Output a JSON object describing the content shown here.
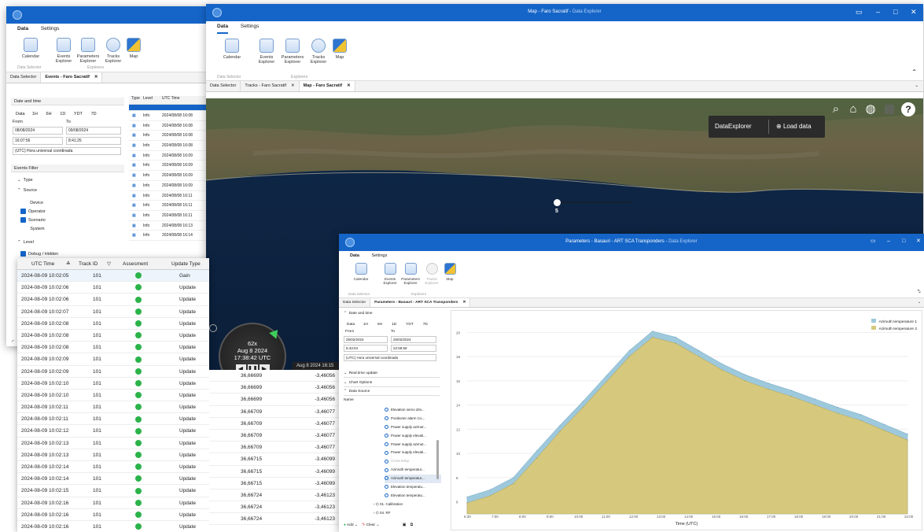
{
  "window_a": {
    "menu": [
      "Data",
      "Settings"
    ],
    "ribbon_buttons": [
      "Calendar",
      "Events Explorer",
      "Parameters Explorer",
      "Tracks Explorer",
      "Map"
    ],
    "group_labels": [
      "Data Selector",
      "Explorers"
    ],
    "tabs": [
      "Data Selector",
      "Events - Faro Sacratif"
    ],
    "date_time_label": "Date and time",
    "ranges": [
      "Data",
      "1H",
      "6H",
      "1D",
      "YDT",
      "7D"
    ],
    "from_label": "From",
    "to_label": "To",
    "from_date": "08/08/2024",
    "to_date": "09/08/2024",
    "from_time": "16:07:56",
    "to_time": "8:41:25",
    "timezone": "(UTC) Hora universal coordinada",
    "events_filter": "Events Filter",
    "type_label": "Type",
    "source_label": "Source",
    "sources": [
      "Device",
      "Operator",
      "Scenario",
      "System"
    ],
    "level_label": "Level",
    "level_item": "Debug / Hidden",
    "table_headers": [
      "Type",
      "Level",
      "UTC Time"
    ],
    "rows": [
      {
        "level": "Info",
        "time": "2024/08/08 16:08"
      },
      {
        "level": "Info",
        "time": "2024/08/08 16:08"
      },
      {
        "level": "Info",
        "time": "2024/08/08 16:08"
      },
      {
        "level": "Info",
        "time": "2024/08/08 16:08"
      },
      {
        "level": "Info",
        "time": "2024/08/08 16:09"
      },
      {
        "level": "Info",
        "time": "2024/08/08 16:09"
      },
      {
        "level": "Info",
        "time": "2024/08/08 16:09"
      },
      {
        "level": "Info",
        "time": "2024/08/08 16:09"
      },
      {
        "level": "Info",
        "time": "2024/08/08 16:11"
      },
      {
        "level": "Info",
        "time": "2024/08/08 16:11"
      },
      {
        "level": "Info",
        "time": "2024/08/08 16:11"
      },
      {
        "level": "Info",
        "time": "2024/08/08 16:13"
      },
      {
        "level": "Info",
        "time": "2024/08/08 16:14"
      }
    ]
  },
  "window_b": {
    "title": "Map - Faro Sacratif",
    "title_app": "Data Explorer",
    "menu": [
      "Data",
      "Settings"
    ],
    "ribbon_buttons": [
      "Calendar",
      "Events Explorer",
      "Parameters Explorer",
      "Tracks Explorer",
      "Map"
    ],
    "group_labels": [
      "Data Selector",
      "Explorers"
    ],
    "tabs": [
      "Data Selector",
      "Tracks - Faro Sacratif",
      "Map - Faro Sacratif"
    ],
    "hud_title": "DataExplorer",
    "load_data": "Load data",
    "marker_label": "5",
    "player": {
      "speed": "62x",
      "date": "Aug 8 2024",
      "time": "17:38:42 UTC"
    },
    "timeline_label": "Aug 8 2024 16:15"
  },
  "track_table": {
    "headers": [
      "UTC Time",
      "Track ID",
      "Assesment",
      "Update Type"
    ],
    "rows": [
      {
        "time": "2024-08-09 10:02:05",
        "id": "101",
        "type": "Gain",
        "lat": "",
        "lon": ""
      },
      {
        "time": "2024-08-09 10:02:06",
        "id": "101",
        "type": "Update",
        "lat": "",
        "lon": ""
      },
      {
        "time": "2024-08-09 10:02:06",
        "id": "101",
        "type": "Update",
        "lat": "",
        "lon": ""
      },
      {
        "time": "2024-08-09 10:02:07",
        "id": "101",
        "type": "Update",
        "lat": "",
        "lon": ""
      },
      {
        "time": "2024-08-09 10:02:08",
        "id": "101",
        "type": "Update",
        "lat": "",
        "lon": ""
      },
      {
        "time": "2024-08-09 10:02:08",
        "id": "101",
        "type": "Update",
        "lat": "",
        "lon": ""
      },
      {
        "time": "2024-08-09 10:02:08",
        "id": "101",
        "type": "Update",
        "lat": "",
        "lon": ""
      },
      {
        "time": "2024-08-09 10:02:09",
        "id": "101",
        "type": "Update",
        "lat": "36,66699",
        "lon": "-3,46056"
      },
      {
        "time": "2024-08-09 10:02:09",
        "id": "101",
        "type": "Update",
        "lat": "36,66699",
        "lon": "-3,46056"
      },
      {
        "time": "2024-08-09 10:02:10",
        "id": "101",
        "type": "Update",
        "lat": "36,66699",
        "lon": "-3,46056"
      },
      {
        "time": "2024-08-09 10:02:10",
        "id": "101",
        "type": "Update",
        "lat": "36,66699",
        "lon": "-3,46056"
      },
      {
        "time": "2024-08-09 10:02:11",
        "id": "101",
        "type": "Update",
        "lat": "36,66699",
        "lon": "-3,46056"
      },
      {
        "time": "2024-08-09 10:02:11",
        "id": "101",
        "type": "Update",
        "lat": "36,66709",
        "lon": "-3,46077"
      },
      {
        "time": "2024-08-09 10:02:12",
        "id": "101",
        "type": "Update",
        "lat": "36,66709",
        "lon": "-3,46077"
      },
      {
        "time": "2024-08-09 10:02:13",
        "id": "101",
        "type": "Update",
        "lat": "36,66709",
        "lon": "-3,46077"
      },
      {
        "time": "2024-08-09 10:02:13",
        "id": "101",
        "type": "Update",
        "lat": "36,66709",
        "lon": "-3,46077"
      },
      {
        "time": "2024-08-09 10:02:14",
        "id": "101",
        "type": "Update",
        "lat": "36,66715",
        "lon": "-3,46099"
      },
      {
        "time": "2024-08-09 10:02:14",
        "id": "101",
        "type": "Update",
        "lat": "36,66715",
        "lon": "-3,46099"
      },
      {
        "time": "2024-08-09 10:02:15",
        "id": "101",
        "type": "Update",
        "lat": "36,66715",
        "lon": "-3,46099"
      },
      {
        "time": "2024-08-09 10:02:16",
        "id": "101",
        "type": "Update",
        "lat": "36,66724",
        "lon": "-3,46123"
      },
      {
        "time": "2024-08-09 10:02:16",
        "id": "101",
        "type": "Update",
        "lat": "36,66724",
        "lon": "-3,46123"
      },
      {
        "time": "2024-08-09 10:02:16",
        "id": "101",
        "type": "Update",
        "lat": "36,66724",
        "lon": "-3,46123"
      }
    ]
  },
  "window_c": {
    "title": "Parameters - Basauri - ART SCA Transponders",
    "title_app": "Data Explorer",
    "menu": [
      "Data",
      "Settings"
    ],
    "ribbon_buttons": [
      "Calendar",
      "Events Explorer",
      "Parameters Explorer",
      "Tracks Explorer",
      "Map"
    ],
    "group_labels": [
      "Data Selector",
      "Explorers"
    ],
    "tabs": [
      "Data Selector",
      "Parameters - Basauri - ART SCA Transponders"
    ],
    "date_time_label": "Date and time",
    "ranges": [
      "Data",
      "1H",
      "6H",
      "1D",
      "YDT",
      "7D"
    ],
    "from_label": "From",
    "to_label": "To",
    "from_date": "25/02/2024",
    "to_date": "25/02/2024",
    "from_time": "6:43:04",
    "to_time": "22:59:59",
    "timezone": "(UTC) Hora universal coordinada",
    "sections": [
      "Real time update",
      "Chart Options",
      "Data Source"
    ],
    "name_header": "Name",
    "tree_items": [
      "Elevation servo driv...",
      "Positioner alarm Co...",
      "Power supply azimut...",
      "Power supply elevati...",
      "Power supply azimut...",
      "Power supply elevati...",
      "Cross temp.",
      "Azimuth temperatur...",
      "Azimuth temperatur...",
      "Elevation temperatu...",
      "Elevation temperatu...",
      "01. Calibration",
      "04. RF"
    ],
    "add_label": "Add",
    "clear_label": "Clear"
  },
  "chart_data": {
    "type": "area",
    "xlabel": "Time (UTC)",
    "x_ticks": [
      "6:30",
      "7:00",
      "8:00",
      "9:00",
      "10:00",
      "11:00",
      "12:00",
      "13:00",
      "14:00",
      "15:00",
      "16:00",
      "17:00",
      "18:00",
      "19:00",
      "20:00",
      "21:00",
      "22:00"
    ],
    "y_ticks": [
      6,
      8,
      10,
      12,
      14,
      16,
      18,
      20
    ],
    "ylim": [
      5,
      21
    ],
    "legend_position": "top-right",
    "x": [
      "6:30",
      "7:00",
      "8:00",
      "9:00",
      "10:00",
      "11:00",
      "12:00",
      "12:30",
      "13:00",
      "13:30",
      "14:00",
      "15:00",
      "16:00",
      "17:00",
      "18:00",
      "19:00",
      "20:00",
      "21:00",
      "22:00",
      "22:45"
    ],
    "series": [
      {
        "name": "Azimuth temperature 1",
        "color": "#9ec9dc",
        "values": [
          6.4,
          7.0,
          8.0,
          10.2,
          12.3,
          14.3,
          16.4,
          18.5,
          20.1,
          19.6,
          18.5,
          17.4,
          16.5,
          15.8,
          15.2,
          14.5,
          13.8,
          13.2,
          12.4,
          11.6
        ]
      },
      {
        "name": "Azimuth temperature 2",
        "color": "#d6c97e",
        "values": [
          5.9,
          6.5,
          7.5,
          9.6,
          11.8,
          13.8,
          15.9,
          18.0,
          19.6,
          19.1,
          18.0,
          16.9,
          16.0,
          15.3,
          14.7,
          14.0,
          13.3,
          12.7,
          11.9,
          11.1
        ]
      }
    ]
  }
}
